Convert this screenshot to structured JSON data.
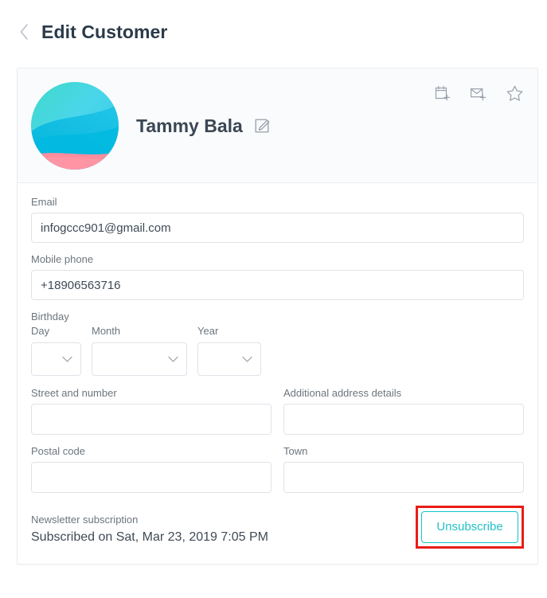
{
  "header": {
    "back_icon": "chevron-left-icon",
    "title": "Edit Customer"
  },
  "customer_card": {
    "avatar_alt": "customer-avatar",
    "name": "Tammy Bala",
    "edit_name_icon": "edit-pencil-icon",
    "actions": [
      {
        "name": "add-appointment-icon",
        "icon": "calendar-plus-icon"
      },
      {
        "name": "send-message-icon",
        "icon": "envelope-plus-icon"
      },
      {
        "name": "favorite-icon",
        "icon": "star-icon"
      }
    ],
    "fields": {
      "email": {
        "label": "Email",
        "value": "infogccc901@gmail.com",
        "placeholder": ""
      },
      "mobile_phone": {
        "label": "Mobile phone",
        "value": "+18906563716",
        "placeholder": ""
      },
      "birthday": {
        "label": "Birthday",
        "day": {
          "label": "Day",
          "value": "",
          "placeholder": ""
        },
        "month": {
          "label": "Month",
          "value": "",
          "placeholder": ""
        },
        "year": {
          "label": "Year",
          "value": "",
          "placeholder": ""
        }
      },
      "street": {
        "label": "Street and number",
        "value": "",
        "placeholder": ""
      },
      "additional_address": {
        "label": "Additional address details",
        "value": "",
        "placeholder": ""
      },
      "postal_code": {
        "label": "Postal code",
        "value": "",
        "placeholder": ""
      },
      "town": {
        "label": "Town",
        "value": "",
        "placeholder": ""
      }
    },
    "newsletter": {
      "label": "Newsletter subscription",
      "status": "Subscribed on Sat, Mar 23, 2019 7:05 PM",
      "unsubscribe_label": "Unsubscribe"
    }
  },
  "colors": {
    "accent_teal": "#23c1c7",
    "highlight_red": "#e81d16",
    "title_text": "#2b3a4a",
    "label_text": "#6c757d",
    "card_header_bg": "#fafbfc"
  }
}
